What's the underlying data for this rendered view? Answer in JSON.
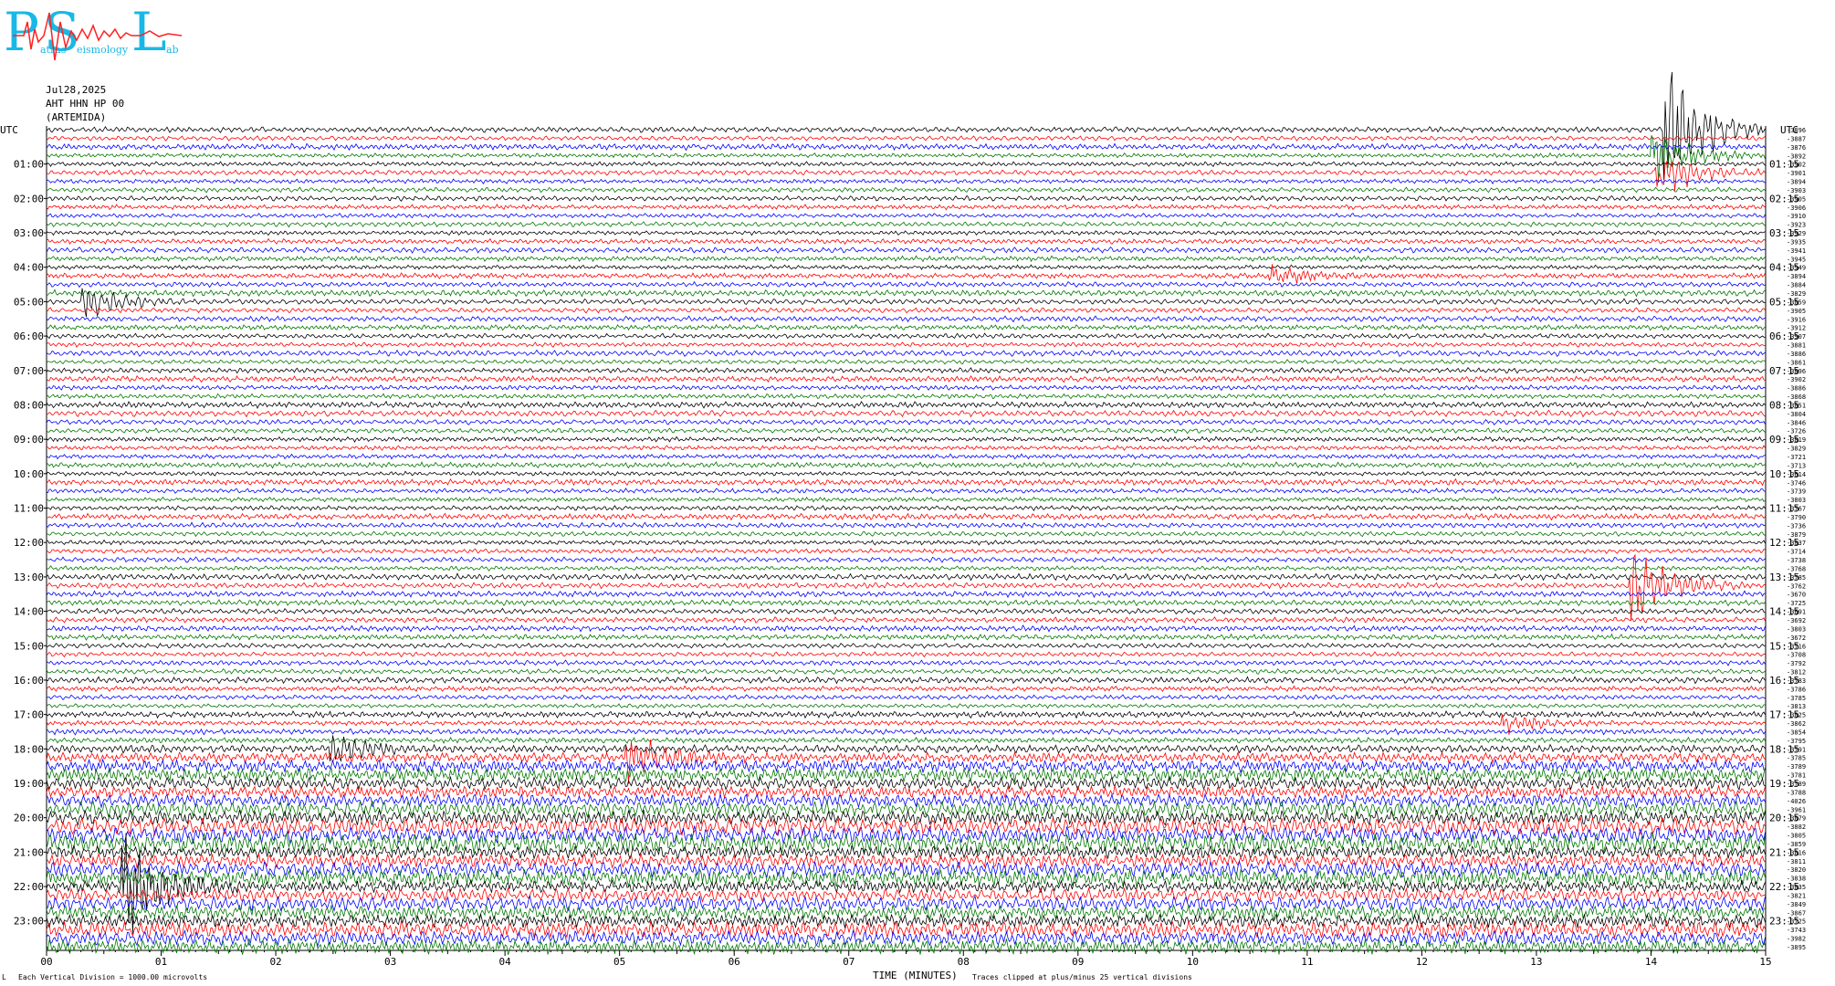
{
  "header": {
    "date": "Jul28,2025",
    "station": "AHT HHN HP 00",
    "site": "(ARTEMIDA)"
  },
  "logo": {
    "letters": [
      "P",
      "S",
      "L"
    ],
    "subtext": [
      "atras",
      "eismology",
      "ab"
    ]
  },
  "footer": {
    "division": "Each Vertical Division = 1000.00 microvolts",
    "clip": "Traces clipped at plus/minus 25 vertical divisions",
    "corner": "L"
  },
  "colors": {
    "trace_cycle": [
      "#000000",
      "#ff0000",
      "#0000ff",
      "#007700"
    ],
    "logo": "#19b8e6"
  },
  "chart_data": {
    "type": "line",
    "title": "",
    "xlabel": "TIME (MINUTES)",
    "ylabel": "UTC",
    "ylabel_right": "UTC",
    "x_ticks": [
      "00",
      "01",
      "02",
      "03",
      "04",
      "05",
      "06",
      "07",
      "08",
      "09",
      "10",
      "11",
      "12",
      "13",
      "14",
      "15"
    ],
    "xlim": [
      0,
      15
    ],
    "left_hour_labels": [
      "01:00",
      "02:00",
      "03:00",
      "04:00",
      "05:00",
      "06:00",
      "07:00",
      "08:00",
      "09:00",
      "10:00",
      "11:00",
      "12:00",
      "13:00",
      "14:00",
      "15:00",
      "16:00",
      "17:00",
      "18:00",
      "19:00",
      "20:00",
      "21:00",
      "22:00",
      "23:00"
    ],
    "right_hour_labels": [
      "01:15",
      "02:15",
      "03:15",
      "04:15",
      "05:15",
      "06:15",
      "07:15",
      "08:15",
      "09:15",
      "10:15",
      "11:15",
      "12:15",
      "13:15",
      "14:15",
      "15:15",
      "16:15",
      "17:15",
      "18:15",
      "19:15",
      "20:15",
      "21:15",
      "22:15",
      "23:15"
    ],
    "trace_count": 96,
    "trace_interval_minutes": 15,
    "offsets": [
      "-3896",
      "-3887",
      "-3876",
      "-3892",
      "-3902",
      "-3901",
      "-3894",
      "-3903",
      "-3905",
      "-3906",
      "-3910",
      "-3923",
      "-3929",
      "-3935",
      "-3941",
      "-3945",
      "-3949",
      "-3894",
      "-3884",
      "-3829",
      "-3859",
      "-3905",
      "-3916",
      "-3912",
      "-3907",
      "-3881",
      "-3886",
      "-3861",
      "-3896",
      "-3902",
      "-3886",
      "-3868",
      "-3851",
      "-3804",
      "-3846",
      "-3726",
      "-3819",
      "-3829",
      "-3721",
      "-3713",
      "-3614",
      "-3746",
      "-3739",
      "-3803",
      "-3767",
      "-3790",
      "-3736",
      "-3879",
      "-3837",
      "-3714",
      "-3738",
      "-3768",
      "-3785",
      "-3762",
      "-3670",
      "-3725",
      "-3691",
      "-3692",
      "-3803",
      "-3672",
      "-3716",
      "-3708",
      "-3792",
      "-3812",
      "-3783",
      "-3786",
      "-3785",
      "-3813",
      "-3825",
      "-3862",
      "-3854",
      "-3795",
      "-3791",
      "-3785",
      "-3789",
      "-3781",
      "-3789",
      "-3788",
      "-4026",
      "-3961",
      "-3879",
      "-3882",
      "-3805",
      "-3859",
      "-3816",
      "-3811",
      "-3820",
      "-3838",
      "-3835",
      "-3821",
      "-3849",
      "-3867",
      "-3725",
      "-3743",
      "-3982",
      "-3895"
    ],
    "events": [
      {
        "trace": 0,
        "minute": 14.15,
        "amplitude": 3.0,
        "color": "#ff0000",
        "note": "large spike"
      },
      {
        "trace": 3,
        "minute": 14.05,
        "amplitude": 1.2,
        "color": "#000000"
      },
      {
        "trace": 5,
        "minute": 14.08,
        "amplitude": 1.0,
        "color": "#000000"
      },
      {
        "trace": 17,
        "minute": 10.7,
        "amplitude": 0.4,
        "color": "#0000ff"
      },
      {
        "trace": 20,
        "minute": 0.35,
        "amplitude": 0.8,
        "color": "#007700"
      },
      {
        "trace": 53,
        "minute": 13.85,
        "amplitude": 1.8,
        "color": "#0000ff"
      },
      {
        "trace": 69,
        "minute": 12.75,
        "amplitude": 0.4,
        "color": "#007700"
      },
      {
        "trace": 73,
        "minute": 5.1,
        "amplitude": 0.9,
        "color": "#0000ff"
      },
      {
        "trace": 72,
        "minute": 2.5,
        "amplitude": 0.7,
        "color": "#000000"
      },
      {
        "trace": 88,
        "minute": 0.7,
        "amplitude": 2.2,
        "color": "#0000ff",
        "note": "strong teleseism"
      }
    ]
  }
}
